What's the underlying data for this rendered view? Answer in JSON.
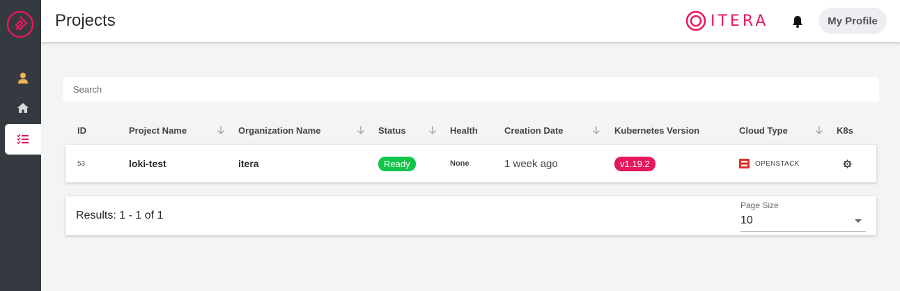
{
  "header": {
    "title": "Projects",
    "brand": "ITERA",
    "profile_label": "My Profile"
  },
  "search": {
    "placeholder": "Search"
  },
  "table": {
    "columns": [
      "ID",
      "Project Name",
      "Organization Name",
      "Status",
      "Health",
      "Creation Date",
      "Kubernetes Version",
      "Cloud Type",
      "K8s"
    ],
    "rows": [
      {
        "id": "53",
        "project_name": "loki-test",
        "organization_name": "itera",
        "status": "Ready",
        "health": "None",
        "creation_date": "1 week ago",
        "kubernetes_version": "v1.19.2",
        "cloud_type": "OPENSTACK"
      }
    ]
  },
  "pagination": {
    "results_text": "Results: 1 - 1 of 1",
    "page_size_label": "Page Size",
    "page_size_value": "10"
  },
  "sidebar": {
    "items": [
      {
        "icon": "user-icon"
      },
      {
        "icon": "home-icon"
      },
      {
        "icon": "list-check-icon",
        "active": true
      }
    ]
  },
  "colors": {
    "accent": "#e6175c",
    "sidebar": "#353a40",
    "status_ready": "#12c44a",
    "user_icon": "#f0b35a"
  }
}
